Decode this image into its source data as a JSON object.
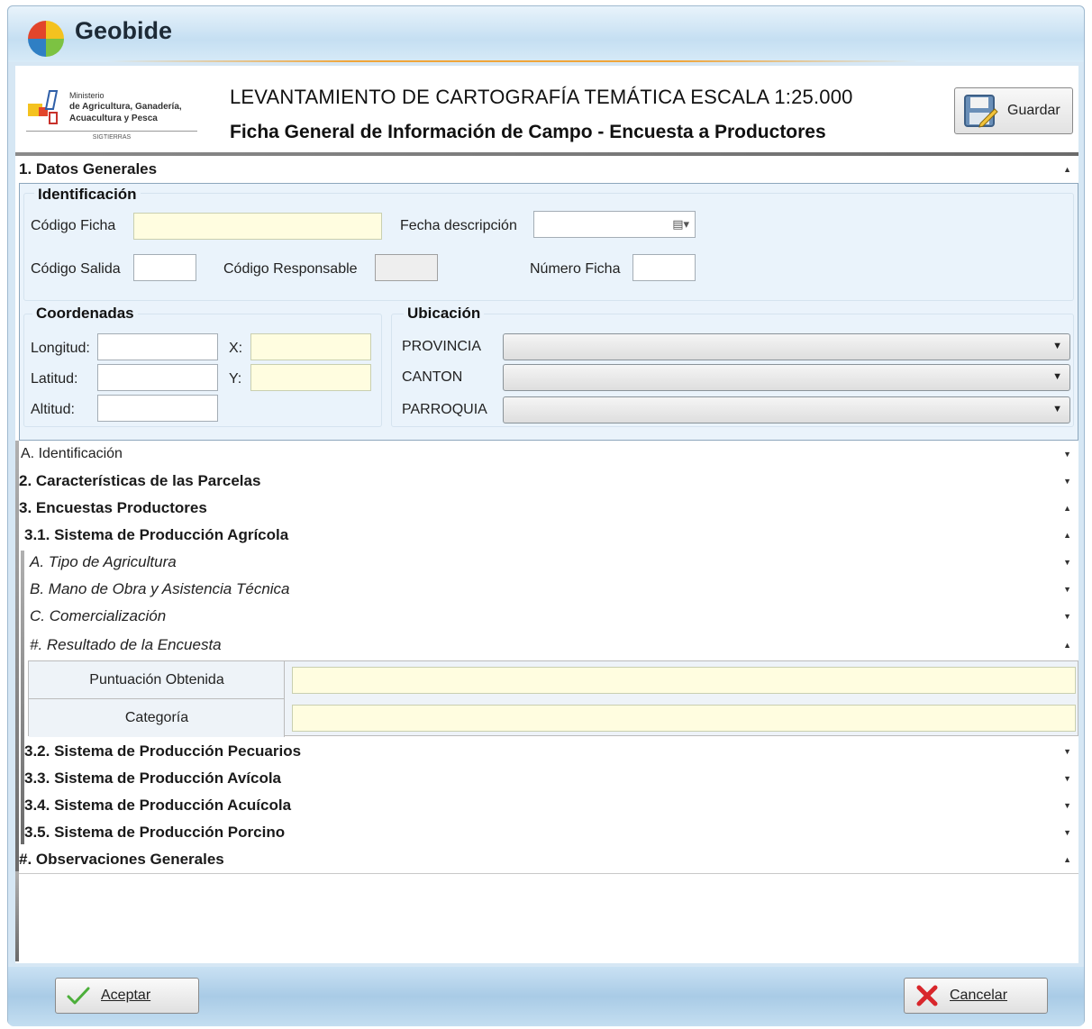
{
  "window": {
    "title": "Geobide"
  },
  "header": {
    "ministry": {
      "line1": "Ministerio",
      "line2": "de Agricultura, Ganadería,",
      "line3": "Acuacultura y Pesca",
      "sub": "SIGTIERRAS"
    },
    "title1": "LEVANTAMIENTO DE CARTOGRAFÍA TEMÁTICA ESCALA 1:25.000",
    "title2": "Ficha General de Información de Campo - Encuesta a Productores",
    "save_label": "Guardar"
  },
  "sections": {
    "datos_generales": "1. Datos Generales",
    "identificacion_a": "A. Identificación",
    "caracteristicas": "2. Características de las Parcelas",
    "encuestas": "3. Encuestas Productores",
    "agricola": "3.1. Sistema de Producción Agrícola",
    "tipo_agricultura": "A. Tipo de Agricultura",
    "mano_obra": "B. Mano de Obra y Asistencia Técnica",
    "comercializacion": "C. Comercialización",
    "resultado": "#. Resultado de la Encuesta",
    "pecuarios": "3.2. Sistema de Producción Pecuarios",
    "avicola": "3.3. Sistema de Producción Avícola",
    "acuicola": "3.4. Sistema de Producción Acuícola",
    "porcino": "3.5. Sistema de Producción Porcino",
    "observaciones": "#. Observaciones Generales"
  },
  "identificacion": {
    "title": "Identificación",
    "codigo_ficha_label": "Código Ficha",
    "codigo_ficha_value": "",
    "fecha_label": "Fecha descripción",
    "fecha_value": "",
    "codigo_salida_label": "Código Salida",
    "codigo_salida_value": "",
    "codigo_responsable_label": "Código Responsable",
    "codigo_responsable_value": "",
    "numero_ficha_label": "Número Ficha",
    "numero_ficha_value": ""
  },
  "coordenadas": {
    "title": "Coordenadas",
    "longitud_label": "Longitud:",
    "latitud_label": "Latitud:",
    "altitud_label": "Altitud:",
    "x_label": "X:",
    "y_label": "Y:"
  },
  "ubicacion": {
    "title": "Ubicación",
    "provincia_label": "PROVINCIA",
    "canton_label": "CANTON",
    "parroquia_label": "PARROQUIA",
    "provincia_value": "",
    "canton_value": "",
    "parroquia_value": ""
  },
  "resultado": {
    "puntuacion_label": "Puntuación Obtenida",
    "categoria_label": "Categoría",
    "puntuacion_value": "",
    "categoria_value": ""
  },
  "footer": {
    "accept_label": "Aceptar",
    "cancel_label": "Cancelar"
  },
  "colors": {
    "window_blue": "#d6e7f4",
    "panel_blue": "#eaf3fb",
    "input_yellow": "#fffde0",
    "accent_orange": "#f0a53a"
  }
}
